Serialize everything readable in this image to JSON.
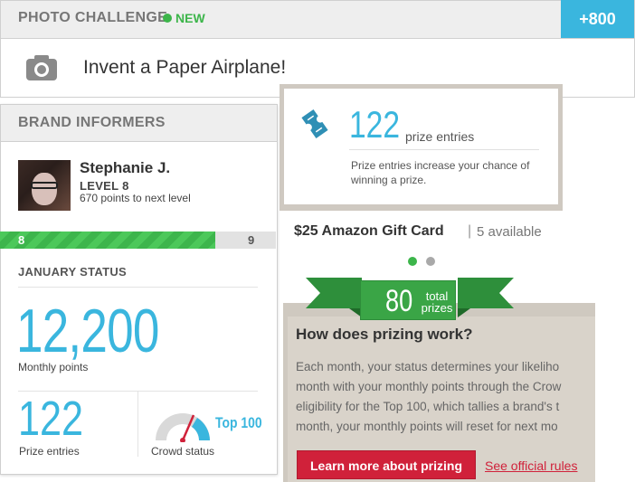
{
  "photo_challenge": {
    "title": "PHOTO CHALLENGE",
    "status": "NEW",
    "points": "+800",
    "task": "Invent a Paper Airplane!",
    "icon": "camera-icon",
    "status_color": "#3cb54a",
    "accent_color": "#3ab6de"
  },
  "brand_informers": {
    "title": "BRAND INFORMERS",
    "user": {
      "name": "Stephanie J.",
      "level": "LEVEL 8",
      "next_level_text": "670 points to next level"
    },
    "level_bar": {
      "current": "8",
      "next": "9",
      "progress": 0.78
    },
    "status_title": "JANUARY STATUS",
    "monthly_points": "12,200",
    "monthly_points_label": "Monthly points",
    "prize_entries": "122",
    "prize_entries_label": "Prize entries",
    "crowd_status": "Top 100",
    "crowd_status_label": "Crowd status"
  },
  "prize": {
    "icon": "ticket-icon",
    "entries": "122",
    "entries_label": "prize entries",
    "description": "Prize entries increase your chance of winning a prize.",
    "gift_name": "$25 Amazon Gift Card",
    "separator": "|",
    "gift_available": "5 available",
    "total_count": "80",
    "total_label_line1": "total",
    "total_label_line2": "prizes"
  },
  "how_it_works": {
    "title": "How does prizing work?",
    "lines": [
      "Each month, your status determines your likeliho",
      "month with your monthly points through the Crow",
      "eligibility for the Top 100, which tallies a brand's t",
      "month, your monthly points will reset for next mo"
    ],
    "learn_button": "Learn more about prizing",
    "rules_link": "See official rules",
    "button_color": "#d0213a"
  }
}
